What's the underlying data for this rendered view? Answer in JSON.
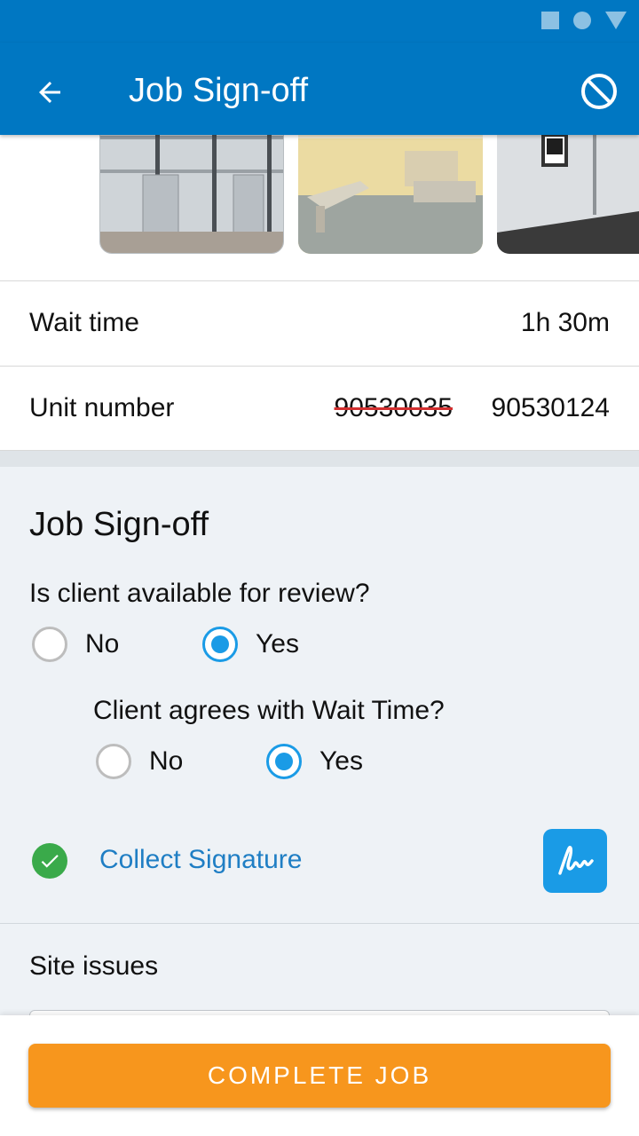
{
  "app_bar": {
    "title": "Job Sign-off"
  },
  "details": {
    "wait_time": {
      "label": "Wait time",
      "value": "1h 30m"
    },
    "unit_number": {
      "label": "Unit number",
      "old_value": "90530035",
      "value": "90530124"
    }
  },
  "signoff": {
    "title": "Job Sign-off",
    "q1": {
      "text": "Is client available for review?",
      "no_label": "No",
      "yes_label": "Yes",
      "selected": "Yes"
    },
    "q2": {
      "text": "Client agrees with Wait Time?",
      "no_label": "No",
      "yes_label": "Yes",
      "selected": "Yes"
    },
    "collect_signature": "Collect Signature",
    "site_issues_label": "Site issues"
  },
  "bottom": {
    "complete_label": "COMPLETE JOB"
  },
  "colors": {
    "primary": "#0077c2",
    "radio_active": "#1a9be6",
    "success": "#3aaa4a",
    "accent_orange": "#f7961d",
    "strike_red": "#d32f2f"
  },
  "icons": [
    "back-arrow-icon",
    "cancel-icon",
    "check-circle-icon",
    "signature-icon"
  ]
}
